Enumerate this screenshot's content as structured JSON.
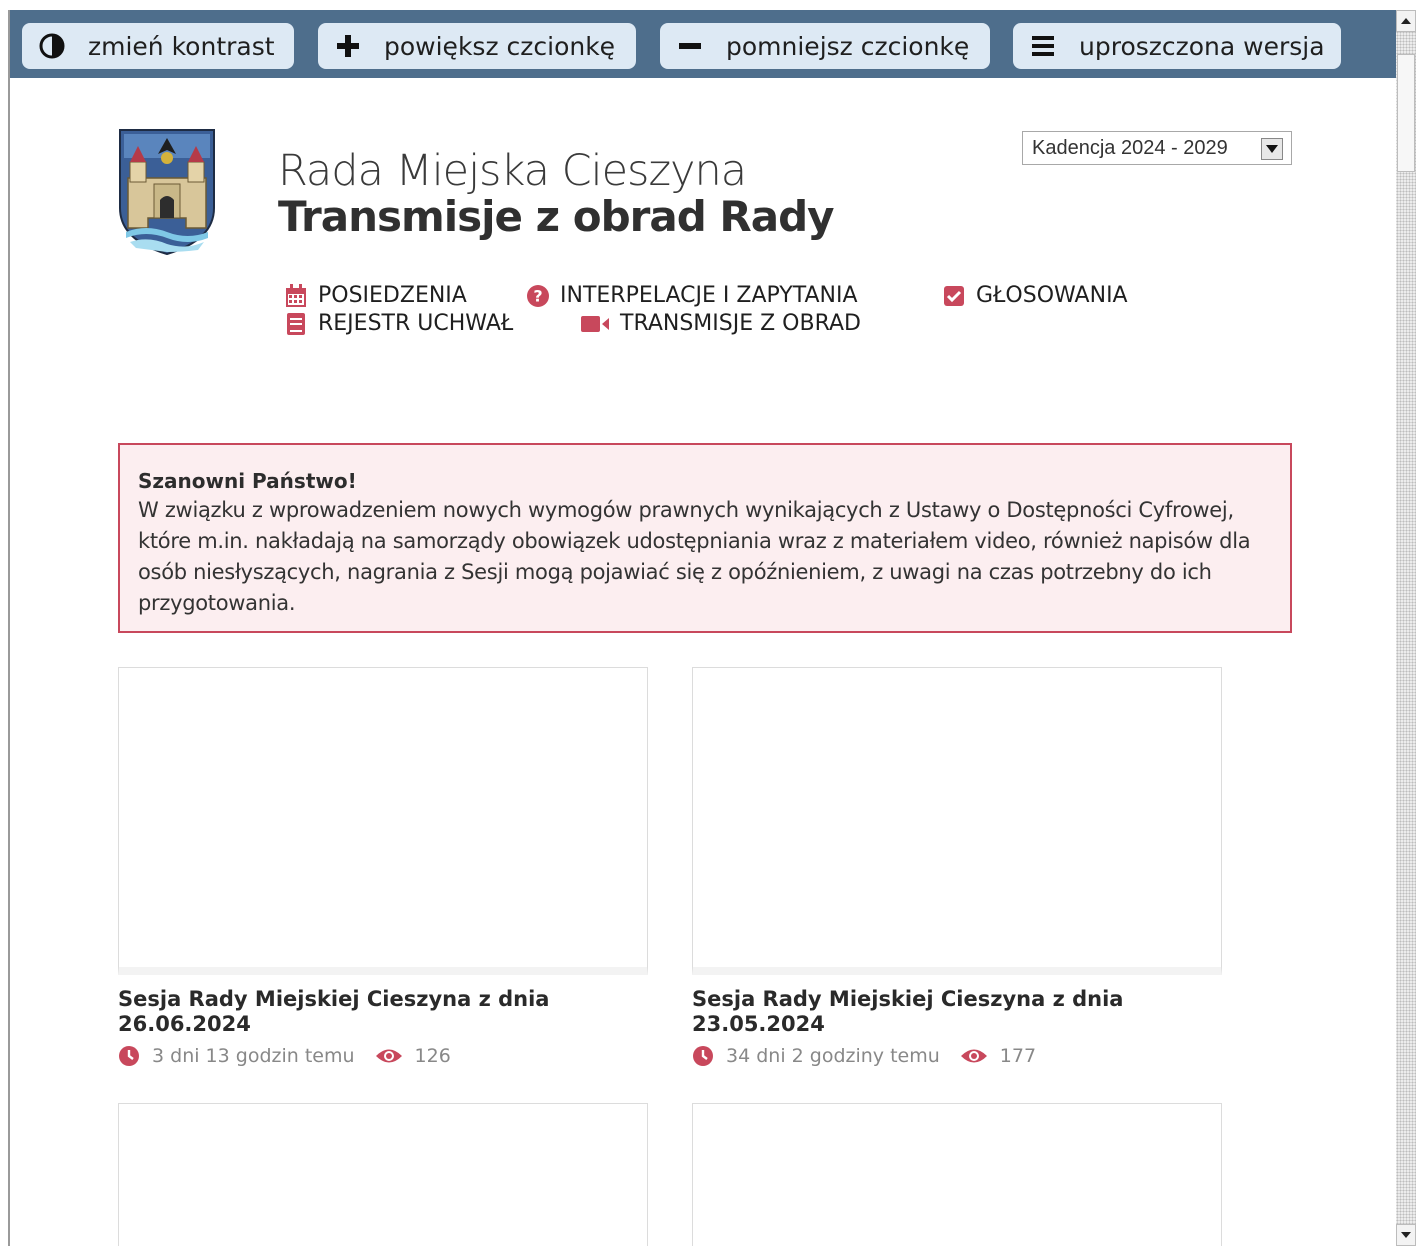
{
  "accessibility_bar": {
    "contrast_label": "zmień kontrast",
    "bigger_font_label": "powiększ czcionkę",
    "smaller_font_label": "pomniejsz czcionkę",
    "simple_version_label": "uproszczona wersja"
  },
  "header": {
    "title_line1": "Rada Miejska Cieszyna",
    "title_line2": "Transmisje z obrad Rady",
    "term_selected": "Kadencja 2024 - 2029"
  },
  "nav": {
    "items": [
      {
        "label": "POSIEDZENIA",
        "icon": "calendar-icon"
      },
      {
        "label": "INTERPELACJE I ZAPYTANIA",
        "icon": "question-icon"
      },
      {
        "label": "GŁOSOWANIA",
        "icon": "checkbox-icon"
      },
      {
        "label": "REJESTR UCHWAŁ",
        "icon": "book-icon"
      },
      {
        "label": "TRANSMISJE Z OBRAD",
        "icon": "video-camera-icon"
      }
    ]
  },
  "notice": {
    "title": "Szanowni Państwo!",
    "body": "W związku z wprowadzeniem nowych wymogów prawnych wynikających z Ustawy o Dostępności Cyfrowej, które m.in. nakładają na samorządy obowiązek udostępniania wraz z materiałem video, również napisów dla osób niesłyszących, nagrania z Sesji mogą pojawiać się z opóźnieniem, z uwagi na czas potrzebny do ich przygotowania."
  },
  "videos": [
    {
      "title": "Sesja Rady Miejskiej Cieszyna z dnia 26.06.2024",
      "time_ago": "3 dni 13 godzin temu",
      "views": "126"
    },
    {
      "title": "Sesja Rady Miejskiej Cieszyna z dnia 23.05.2024",
      "time_ago": "34 dni 2 godziny temu",
      "views": "177"
    }
  ],
  "colors": {
    "toolbar_bg": "#4e6e8c",
    "toolbar_button_bg": "#dde9f4",
    "accent": "#c8485c",
    "notice_bg": "#fceef0"
  }
}
